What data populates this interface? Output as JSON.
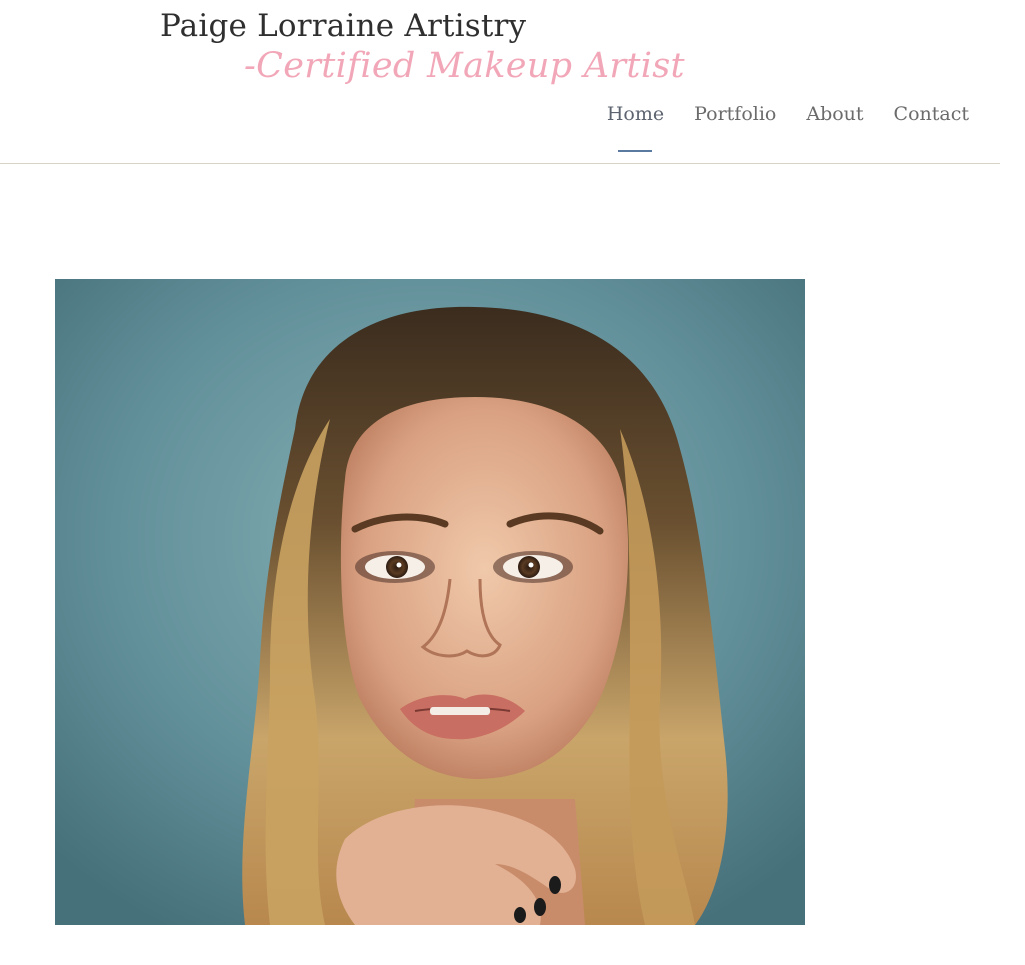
{
  "site": {
    "title": "Paige Lorraine Artistry",
    "tagline": "-Certified Makeup Artist"
  },
  "nav": {
    "items": [
      {
        "label": "Home",
        "active": true
      },
      {
        "label": "Portfolio",
        "active": false
      },
      {
        "label": "About",
        "active": false
      },
      {
        "label": "Contact",
        "active": false
      }
    ]
  },
  "colors": {
    "title": "#2f2f2f",
    "tagline": "#f2a7b8",
    "nav_text": "#6b6b6b",
    "nav_active_underline": "#5b7aa0",
    "header_border": "#d6d3c6",
    "photo_background": "#6b959c"
  }
}
